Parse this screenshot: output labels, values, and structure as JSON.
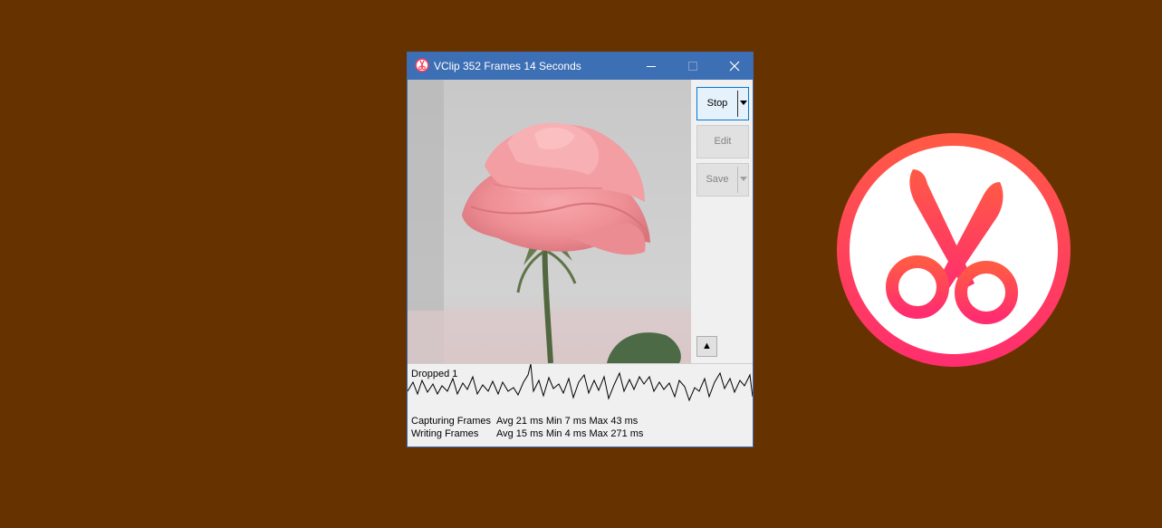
{
  "window": {
    "title": "VClip 352 Frames 14 Seconds",
    "app_icon": "scissors-icon",
    "controls": [
      "minimize-icon",
      "maximize-icon",
      "close-icon"
    ]
  },
  "side_panel": {
    "stop_label": "Stop",
    "edit_label": "Edit",
    "save_label": "Save",
    "expand_label": "▲"
  },
  "graph": {
    "dropped_label": "Dropped 1",
    "stats": [
      {
        "label": "Capturing Frames",
        "values": "Avg 21 ms Min 7 ms Max 43 ms"
      },
      {
        "label": "Writing Frames",
        "values": "Avg 15 ms Min 4 ms Max 271 ms"
      }
    ]
  },
  "colors": {
    "desktop": "#663300",
    "titlebar": "#3d6fb5",
    "logo_gradient_top": "#ff5a45",
    "logo_gradient_bottom": "#ff2d6f"
  },
  "logo": {
    "icon": "scissors-icon"
  }
}
